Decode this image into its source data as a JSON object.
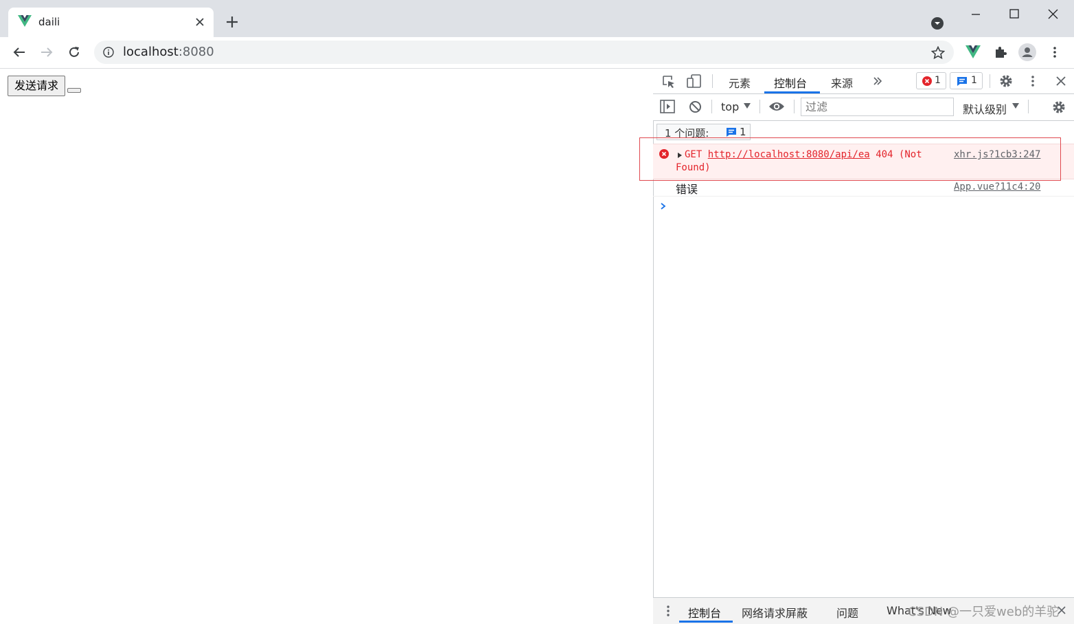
{
  "browser": {
    "tab_title": "daili",
    "url_host": "localhost",
    "url_port": ":8080"
  },
  "page": {
    "send_button_label": "发送请求",
    "empty_button_label": ""
  },
  "devtools": {
    "tabs": [
      "元素",
      "控制台",
      "来源"
    ],
    "active_tab": "控制台",
    "error_count": "1",
    "message_count": "1",
    "context": "top",
    "filter_placeholder": "过滤",
    "level_label": "默认级别",
    "issues_label": "1 个问题:",
    "issues_count": "1",
    "error_method": "GET",
    "error_url": "http://localhost:8080/api/ea",
    "error_status": "404 (Not",
    "error_status_cont": "Found)",
    "error_source": "xhr.js?1cb3:247",
    "log_text": "错误",
    "log_source": "App.vue?11c4:20",
    "drawer_tabs": [
      "控制台",
      "网络请求屏蔽",
      "问题",
      "What's New"
    ]
  },
  "watermark": "CSDN @一只爱web的羊驼",
  "colors": {
    "accent": "#1a73e8",
    "error": "#e3242b",
    "error_bg": "#fff0f0",
    "vue_green": "#41b883"
  }
}
